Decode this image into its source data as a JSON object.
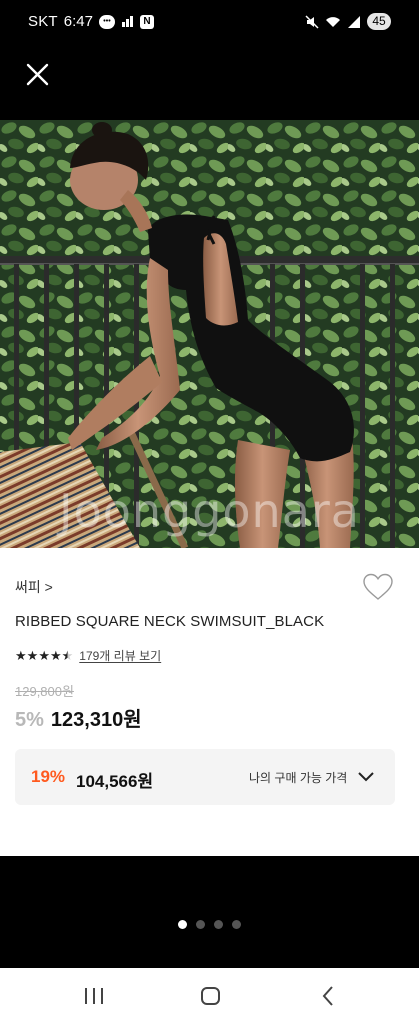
{
  "status_bar": {
    "carrier": "SKT",
    "time": "6:47",
    "notification_icons": [
      "talk-bubble-icon",
      "signal-app-icon",
      "naver-n-icon"
    ],
    "n_icon_label": "N",
    "battery": "45"
  },
  "header": {
    "close_icon": "close-icon"
  },
  "image": {
    "watermark": "Joonggonara"
  },
  "product": {
    "brand": "써피 >",
    "title": "RIBBED SQUARE NECK SWIMSUIT_BLACK",
    "rating_stars": 4.5,
    "review_link": "179개 리뷰 보기",
    "original_price": "129,800원",
    "discount_rate": "5%",
    "sale_price": "123,310원"
  },
  "my_price": {
    "rate": "19%",
    "price": "104,566원",
    "label": "나의 구매 가능 가격"
  },
  "carousel": {
    "total": 4,
    "active_index": 0
  },
  "colors": {
    "accent_orange": "#ff5a1f",
    "discount_gray": "#b8b8b8"
  }
}
